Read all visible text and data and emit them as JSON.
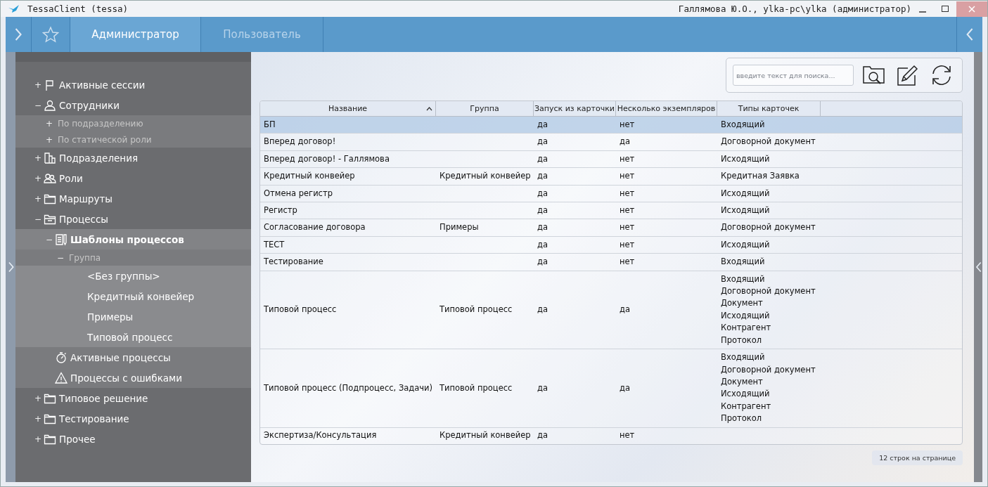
{
  "window": {
    "title": "TessaClient (tessa)",
    "user": "Галлямова Ю.О., ylka-pc\\ylka (администратор)"
  },
  "tabs": [
    {
      "label": "Администратор",
      "selected": true
    },
    {
      "label": "Пользователь",
      "selected": false
    }
  ],
  "tree": [
    {
      "label": "Активные сессии",
      "toggle": "+",
      "kind": "flag",
      "selected": false
    },
    {
      "label": "Сотрудники",
      "toggle": "−",
      "kind": "person",
      "selected": false,
      "children": [
        {
          "label": "По подразделению",
          "toggle": "+",
          "selected": false
        },
        {
          "label": "По статической роли",
          "toggle": "+",
          "selected": false
        }
      ]
    },
    {
      "label": "Подразделения",
      "toggle": "+",
      "kind": "building",
      "selected": false
    },
    {
      "label": "Роли",
      "toggle": "+",
      "kind": "people",
      "selected": false
    },
    {
      "label": "Маршруты",
      "toggle": "+",
      "kind": "folder",
      "selected": false
    },
    {
      "label": "Процессы",
      "toggle": "−",
      "kind": "folder-open",
      "selected": false,
      "children": [
        {
          "label": "Шаблоны процессов",
          "toggle": "−",
          "kind": "document",
          "selected": true,
          "children": [
            {
              "label": "Группа",
              "toggle": "−",
              "selected": false,
              "children": [
                {
                  "label": "<Без группы>",
                  "selected": false
                },
                {
                  "label": "Кредитный конвейер",
                  "selected": false
                },
                {
                  "label": "Примеры",
                  "selected": false
                },
                {
                  "label": "Типовой процесс",
                  "selected": false
                }
              ]
            }
          ]
        },
        {
          "label": "Активные процессы",
          "kind": "stopwatch",
          "selected": false
        },
        {
          "label": "Процессы с ошибками",
          "kind": "warning",
          "selected": false
        }
      ]
    },
    {
      "label": "Типовое решение",
      "toggle": "+",
      "kind": "folder",
      "selected": false
    },
    {
      "label": "Тестирование",
      "toggle": "+",
      "kind": "folder",
      "selected": false
    },
    {
      "label": "Прочее",
      "toggle": "+",
      "kind": "folder",
      "selected": false
    }
  ],
  "search": {
    "placeholder": "введите текст для поиска..."
  },
  "table": {
    "columns": [
      {
        "label": "Название",
        "sorted": true
      },
      {
        "label": "Группа",
        "sorted": false
      },
      {
        "label": "Запуск из карточки",
        "sorted": false
      },
      {
        "label": "Несколько экземпляров",
        "sorted": false
      },
      {
        "label": "Типы карточек",
        "sorted": false
      }
    ],
    "rows": [
      {
        "selected": true,
        "cells": [
          "БП",
          "",
          "да",
          "нет",
          [
            "Входящий"
          ]
        ]
      },
      {
        "selected": false,
        "cells": [
          "Вперед договор!",
          "",
          "да",
          "да",
          [
            "Договорной документ"
          ]
        ]
      },
      {
        "selected": false,
        "cells": [
          "Вперед договор! - Галлямова",
          "",
          "да",
          "нет",
          [
            "Исходящий"
          ]
        ]
      },
      {
        "selected": false,
        "cells": [
          "Кредитный конвейер",
          "Кредитный конвейер",
          "да",
          "нет",
          [
            "Кредитная Заявка"
          ]
        ]
      },
      {
        "selected": false,
        "cells": [
          "Отмена регистр",
          "",
          "да",
          "нет",
          [
            "Исходящий"
          ]
        ]
      },
      {
        "selected": false,
        "cells": [
          "Регистр",
          "",
          "да",
          "нет",
          [
            "Исходящий"
          ]
        ]
      },
      {
        "selected": false,
        "cells": [
          "Согласование договора",
          "Примеры",
          "да",
          "нет",
          [
            "Договорной документ"
          ]
        ]
      },
      {
        "selected": false,
        "cells": [
          "ТЕСТ",
          "",
          "да",
          "нет",
          [
            "Исходящий"
          ]
        ]
      },
      {
        "selected": false,
        "cells": [
          "Тестирование",
          "",
          "да",
          "нет",
          [
            "Входящий"
          ]
        ]
      },
      {
        "selected": false,
        "cells": [
          "Типовой процесс",
          "Типовой процесс",
          "да",
          "да",
          [
            "Входящий",
            "Договорной документ",
            "Документ",
            "Исходящий",
            "Контрагент",
            "Протокол"
          ]
        ]
      },
      {
        "selected": false,
        "cells": [
          "Типовой процесс (Подпроцесс, Задачи)",
          "Типовой процесс",
          "да",
          "да",
          [
            "Входящий",
            "Договорной документ",
            "Документ",
            "Исходящий",
            "Контрагент",
            "Протокол"
          ]
        ]
      },
      {
        "selected": false,
        "cells": [
          "Экспертиза/Консультация",
          "Кредитный конвейер",
          "да",
          "нет",
          ""
        ]
      }
    ]
  },
  "status": "12 строк на странице"
}
